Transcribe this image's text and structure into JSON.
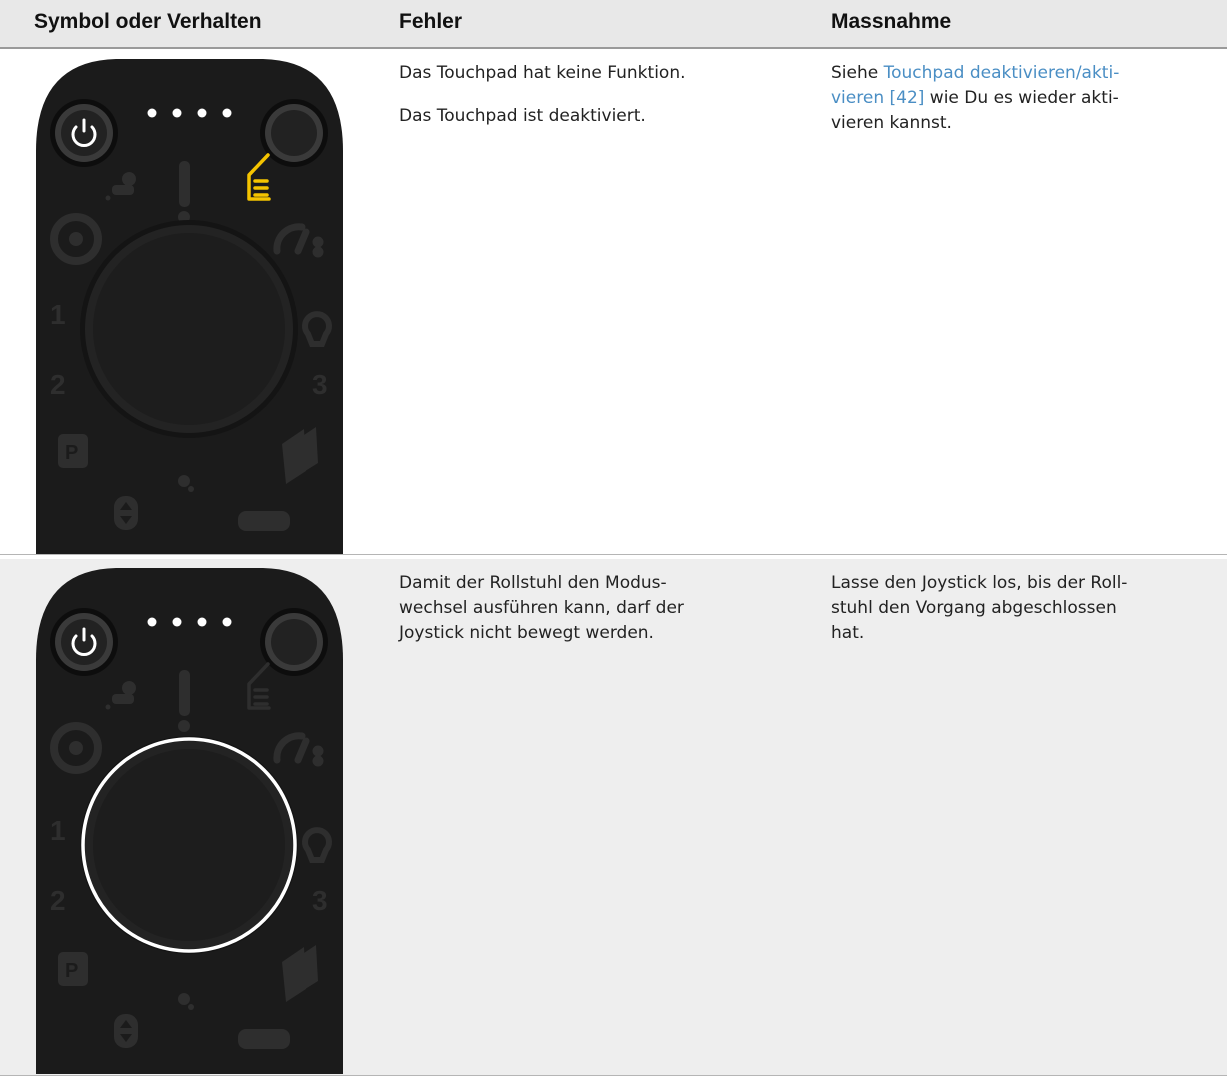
{
  "header": {
    "col1": "Symbol oder Verhalten",
    "col2": "Fehler",
    "col3": "Massnahme"
  },
  "rows": [
    {
      "fehler": [
        "Das Touchpad hat keine Funktion.",
        "Das Touchpad ist deaktiviert."
      ],
      "massnahme_pre": "Siehe ",
      "massnahme_link": "Touchpad deaktivieren/akti-\nvieren [42]",
      "massnahme_post": " wie Du es wieder akti-\nvieren kannst.",
      "device": {
        "highlight": "touchpad-icon",
        "highlight_color": "#f5c400"
      }
    },
    {
      "fehler": "Damit der Rollstuhl den Modus-\nwechsel ausführen kann, darf der\nJoystick nicht bewegt werden.",
      "massnahme": "Lasse den Joystick los, bis der Roll-\nstuhl den Vorgang abgeschlossen\nhat.",
      "device": {
        "highlight": "joystick-ring",
        "highlight_color": "#ffffff"
      }
    }
  ],
  "device_labels": {
    "level1": "1",
    "level2": "2",
    "level3": "3",
    "parking": "P"
  },
  "colors": {
    "header_bg": "#e8e8e8",
    "link": "#4a8ec4",
    "device_body": "#1b1b1b",
    "dim_icon": "#2e2e2e"
  }
}
